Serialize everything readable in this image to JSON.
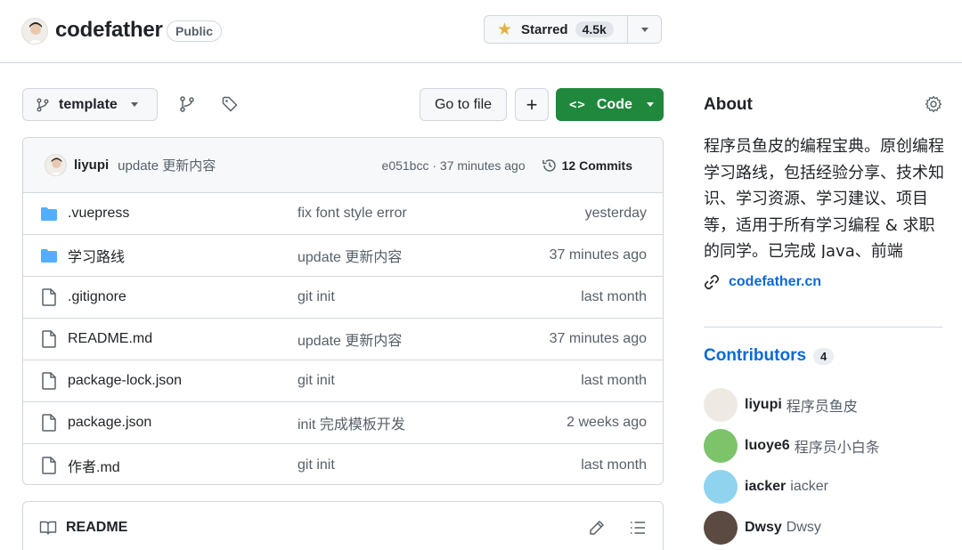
{
  "repo": {
    "owner": "codefather",
    "visibility": "Public",
    "star_label": "Starred",
    "star_count": "4.5k"
  },
  "toolbar": {
    "branch": "template",
    "go_to_file": "Go to file",
    "add_file": "+",
    "code_glyph": "<>",
    "code_label": "Code"
  },
  "last_commit": {
    "author": "liyupi",
    "message": "update 更新内容",
    "sha_time": "e051bcc · 37 minutes ago",
    "commits_label": "12 Commits"
  },
  "files": [
    {
      "icon": "folder-icon",
      "name": ".vuepress",
      "message": "fix font style error",
      "time": "yesterday"
    },
    {
      "icon": "folder-icon",
      "name": "学习路线",
      "message": "update 更新内容",
      "time": "37 minutes ago"
    },
    {
      "icon": "file-icon",
      "name": ".gitignore",
      "message": "git init",
      "time": "last month"
    },
    {
      "icon": "file-icon",
      "name": "README.md",
      "message": "update 更新内容",
      "time": "37 minutes ago"
    },
    {
      "icon": "file-icon",
      "name": "package-lock.json",
      "message": "git init",
      "time": "last month"
    },
    {
      "icon": "file-icon",
      "name": "package.json",
      "message": "init 完成模板开发",
      "time": "2 weeks ago"
    },
    {
      "icon": "file-icon",
      "name": "作者.md",
      "message": "git init",
      "time": "last month"
    }
  ],
  "readme": {
    "title": "README"
  },
  "about": {
    "title": "About",
    "description": "程序员鱼皮的编程宝典。原创编程学习路线，包括经验分享、技术知识、学习资源、学习建议、项目等，适用于所有学习编程 & 求职的同学。已完成 Java、前端",
    "link": "codefather.cn"
  },
  "contributors": {
    "title": "Contributors",
    "count": "4",
    "items": [
      {
        "login": "liyupi",
        "name": "程序员鱼皮",
        "avatar_color": "#efe9e3"
      },
      {
        "login": "luoye6",
        "name": "程序员小白条",
        "avatar_color": "#7cc36a"
      },
      {
        "login": "iacker",
        "name": "iacker",
        "avatar_color": "#8fd3ef"
      },
      {
        "login": "Dwsy",
        "name": "Dwsy",
        "avatar_color": "#5b4a42"
      }
    ]
  },
  "colors": {
    "code_button": "#1f883d",
    "link": "#0969da",
    "folder": "#54aeff",
    "star": "#e3b341"
  }
}
